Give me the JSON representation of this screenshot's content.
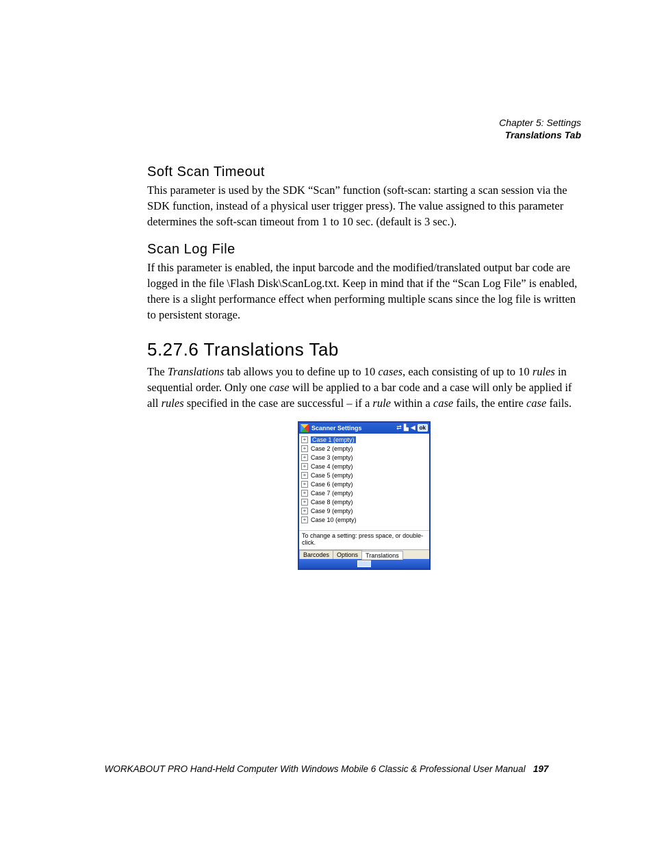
{
  "header": {
    "chapter": "Chapter 5: Settings",
    "section": "Translations Tab"
  },
  "sections": {
    "soft_scan": {
      "title": "Soft Scan Timeout",
      "body": "This parameter is used by the SDK “Scan” function (soft-scan: starting a scan session via the SDK function, instead of a physical user trigger press). The value assigned to this parameter determines the soft-scan timeout from 1 to 10 sec. (default is 3 sec.)."
    },
    "scan_log": {
      "title": "Scan Log File",
      "body": "If this parameter is enabled, the input barcode and the modified/translated output bar code are logged in the file \\Flash Disk\\ScanLog.txt. Keep in mind that if the “Scan Log File” is enabled, there is a slight performance effect when performing multiple scans since the log file is written to persistent storage."
    },
    "translations": {
      "title": "5.27.6  Translations Tab",
      "p1a": "The ",
      "p1b": "Translations",
      "p1c": " tab allows you to define up to 10 ",
      "p1d": "cases",
      "p1e": ", each consisting of up to 10 ",
      "p1f": "rules",
      "p1g": " in sequential order. Only one ",
      "p1h": "case",
      "p1i": " will be applied to a bar code and a case will only be applied if all ",
      "p1j": "rules",
      "p1k": " specified in the case are successful – if a ",
      "p1l": "rule",
      "p1m": " within a ",
      "p1n": "case",
      "p1o": " fails, the entire ",
      "p1p": "case",
      "p1q": " fails."
    }
  },
  "device": {
    "title": "Scanner Settings",
    "ok": "ok",
    "cases": [
      "Case 1 (empty)",
      "Case 2 (empty)",
      "Case 3 (empty)",
      "Case 4 (empty)",
      "Case 5 (empty)",
      "Case 6 (empty)",
      "Case 7 (empty)",
      "Case 8 (empty)",
      "Case 9 (empty)",
      "Case 10 (empty)"
    ],
    "hint": "To change a setting: press space, or double-click.",
    "tabs": [
      "Barcodes",
      "Options",
      "Translations"
    ]
  },
  "footer": {
    "text": "WORKABOUT PRO Hand-Held Computer With Windows Mobile 6 Classic & Professional User Manual",
    "page": "197"
  }
}
